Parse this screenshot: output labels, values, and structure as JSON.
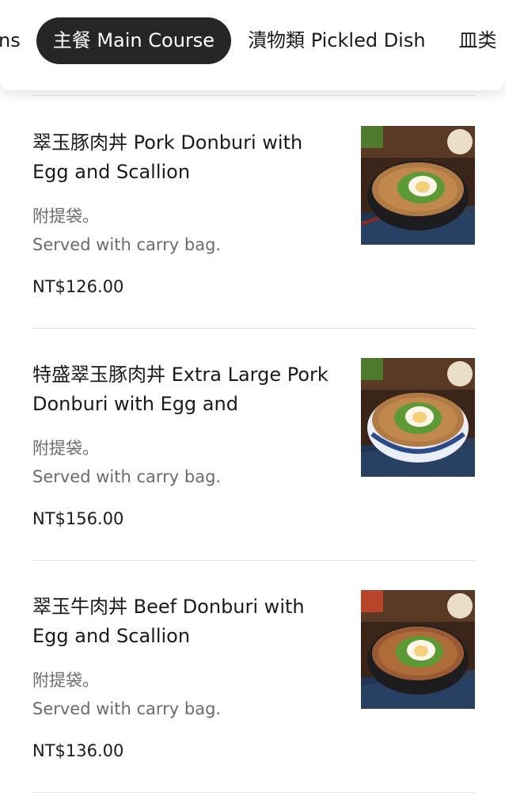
{
  "tabs": [
    {
      "label": "ns",
      "active": false
    },
    {
      "label": "主餐 Main Course",
      "active": true
    },
    {
      "label": "漬物類 Pickled Dish",
      "active": false
    },
    {
      "label": "皿类",
      "active": false
    }
  ],
  "items": [
    {
      "title": "翠玉豚肉丼 Pork Donburi with Egg and Scallion",
      "desc_zh": "附提袋。",
      "desc_en": "Served with carry bag.",
      "price": "NT$126.00",
      "bowl_color": "#1d1d1f"
    },
    {
      "title": "特盛翠玉豚肉丼 Extra Large Pork Donburi with Egg and",
      "desc_zh": "附提袋。",
      "desc_en": "Served with carry bag.",
      "price": "NT$156.00",
      "bowl_color": "#e9eef7"
    },
    {
      "title": "翠玉牛肉丼 Beef Donburi with Egg and Scallion",
      "desc_zh": "附提袋。",
      "desc_en": "Served with carry bag.",
      "price": "NT$136.00",
      "bowl_color": "#1d1d1f"
    }
  ]
}
